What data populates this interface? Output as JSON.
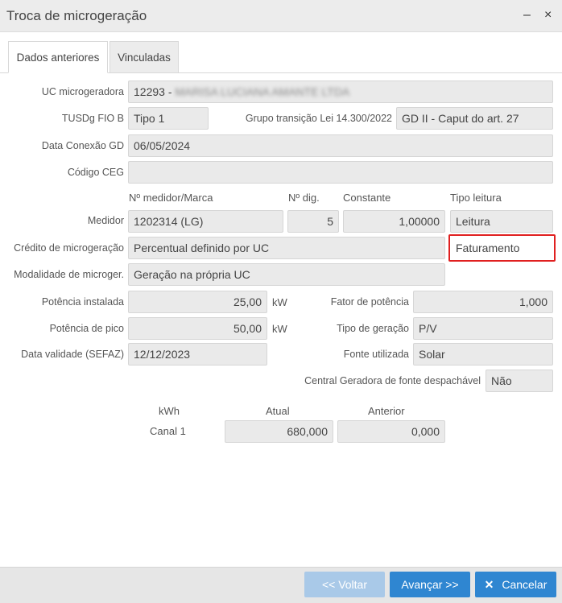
{
  "window": {
    "title": "Troca de microgeração",
    "minimize_glyph": "–",
    "close_glyph": "×"
  },
  "tabs": [
    {
      "label": "Dados anteriores"
    },
    {
      "label": "Vinculadas"
    }
  ],
  "form": {
    "uc_label": "UC microgeradora",
    "uc_code": "12293",
    "uc_sep": "-",
    "uc_name": "MARISA LUCIANA AMANTE LTDA",
    "tusdg_label": "TUSDg FIO B",
    "tusdg_value": "Tipo 1",
    "grupo_label": "Grupo transição Lei 14.300/2022",
    "grupo_value": "GD II - Caput do art. 27",
    "data_conexao_label": "Data Conexão GD",
    "data_conexao_value": "06/05/2024",
    "codigo_ceg_label": "Código CEG",
    "codigo_ceg_value": "",
    "medidor_headers": {
      "marca": "Nº medidor/Marca",
      "dig": "Nº dig.",
      "constante": "Constante",
      "tipo_leitura": "Tipo leitura"
    },
    "medidor_label": "Medidor",
    "medidor_value": "1202314 (LG)",
    "digitos_value": "5",
    "constante_value": "1,00000",
    "tipo_leitura_value": "Leitura",
    "credito_label": "Crédito de microgeração",
    "credito_value": "Percentual definido por UC",
    "faturamento_value": "Faturamento",
    "modalidade_label": "Modalidade de microger.",
    "modalidade_value": "Geração na própria UC",
    "potencia_instalada_label": "Potência instalada",
    "potencia_instalada_value": "25,00",
    "fator_potencia_label": "Fator de potência",
    "fator_potencia_value": "1,000",
    "potencia_pico_label": "Potência de pico",
    "potencia_pico_value": "50,00",
    "tipo_geracao_label": "Tipo de geração",
    "tipo_geracao_value": "P/V",
    "data_validade_label": "Data validade (SEFAZ)",
    "data_validade_value": "12/12/2023",
    "fonte_label": "Fonte utilizada",
    "fonte_value": "Solar",
    "central_label": "Central Geradora de fonte despachável",
    "central_value": "Não",
    "unit_kw": "kW"
  },
  "readings": {
    "headers": {
      "unit": "kWh",
      "atual": "Atual",
      "anterior": "Anterior"
    },
    "rows": [
      {
        "label": "Canal 1",
        "atual": "680,000",
        "anterior": "0,000"
      }
    ]
  },
  "footer": {
    "back_label": "<< Voltar",
    "next_label": "Avançar >>",
    "cancel_icon": "✕",
    "cancel_label": "Cancelar"
  }
}
